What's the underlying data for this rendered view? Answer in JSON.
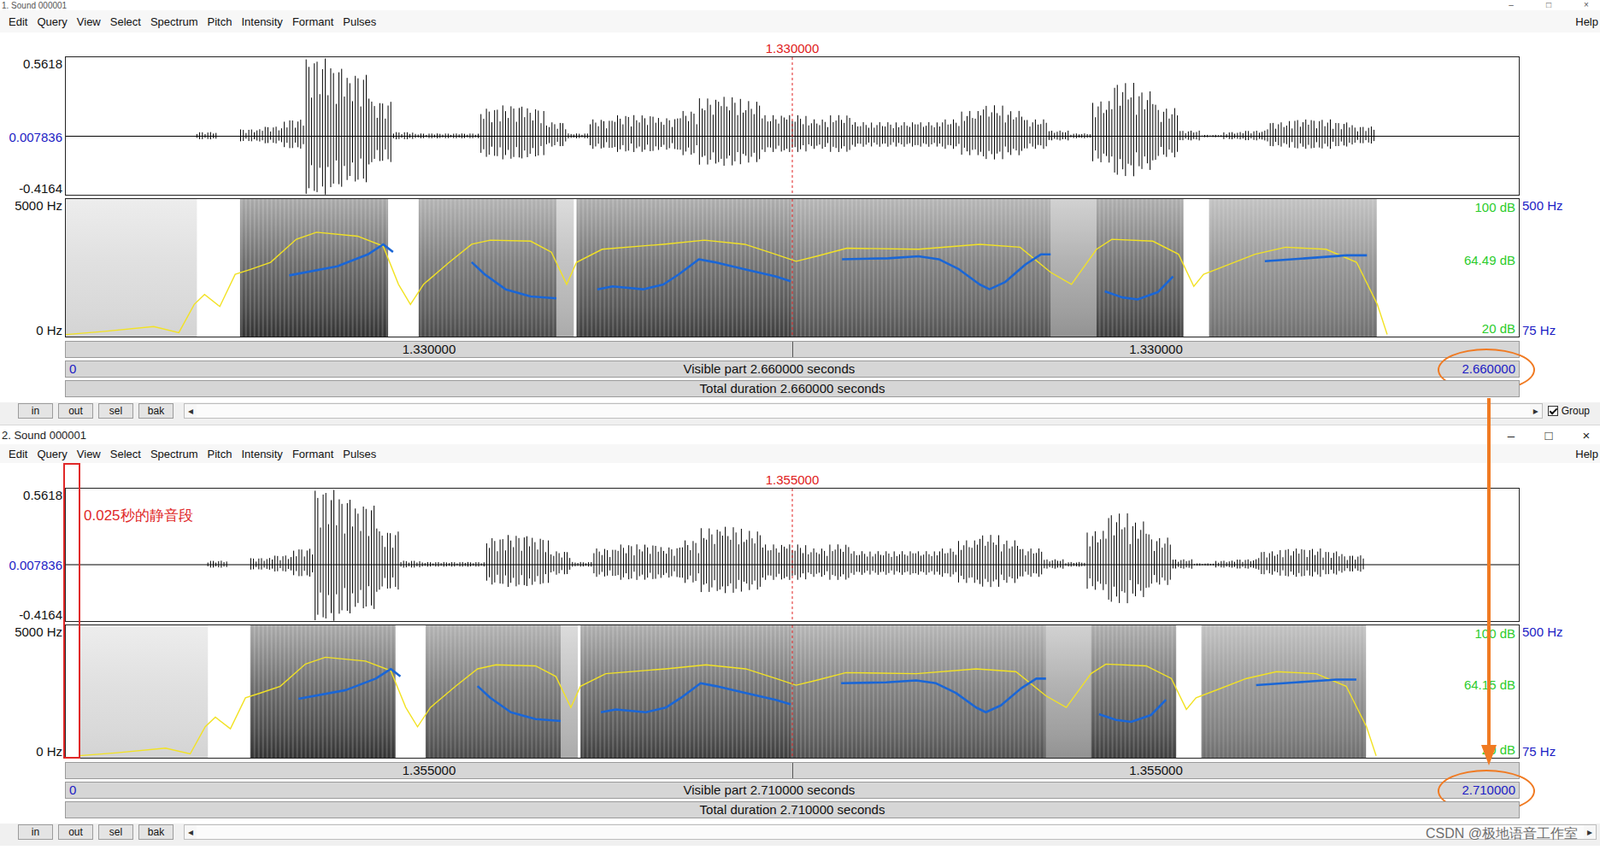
{
  "windows": [
    {
      "title": "1. Sound 000001",
      "controls": [
        "–",
        "□",
        "×"
      ],
      "menus": [
        "Edit",
        "Query",
        "View",
        "Select",
        "Spectrum",
        "Pitch",
        "Intensity",
        "Formant",
        "Pulses"
      ],
      "help": "Help",
      "cursor": "1.330000",
      "signal_offset": 0,
      "waveform": {
        "max": "0.5618",
        "zero": "0.007836",
        "min": "-0.4164"
      },
      "spectrogram": {
        "freq_top": "5000 Hz",
        "freq_bottom": "0 Hz",
        "db_top": "100 dB",
        "db_mean": "64.49 dB",
        "db_bottom": "20 dB",
        "pitch_top": "500 Hz",
        "pitch_bottom": "75 Hz"
      },
      "time_bar": [
        "1.330000",
        "1.330000"
      ],
      "visible": {
        "start": "0",
        "label": "Visible part 2.660000 seconds",
        "end": "2.660000",
        "circled": true
      },
      "total": "Total duration 2.660000 seconds",
      "buttons": [
        "in",
        "out",
        "sel",
        "bak"
      ],
      "scroll_left": "◂",
      "scroll_right": "▸",
      "group": {
        "label": "Group",
        "checked": true
      },
      "silence_note": null
    },
    {
      "title": "2. Sound 000001",
      "controls": [
        "–",
        "□",
        "×"
      ],
      "menus": [
        "Edit",
        "Query",
        "View",
        "Select",
        "Spectrum",
        "Pitch",
        "Intensity",
        "Formant",
        "Pulses"
      ],
      "help": "Help",
      "cursor": "1.355000",
      "signal_offset": 0.025,
      "waveform": {
        "max": "0.5618",
        "zero": "0.007836",
        "min": "-0.4164"
      },
      "spectrogram": {
        "freq_top": "5000 Hz",
        "freq_bottom": "0 Hz",
        "db_top": "100 dB",
        "db_mean": "64.15 dB",
        "db_bottom": "20 dB",
        "pitch_top": "500 Hz",
        "pitch_bottom": "75 Hz"
      },
      "time_bar": [
        "1.355000",
        "1.355000"
      ],
      "visible": {
        "start": "0",
        "label": "Visible part 2.710000 seconds",
        "end": "2.710000",
        "circled": true
      },
      "total": "Total duration 2.710000 seconds",
      "buttons": [
        "in",
        "out",
        "sel",
        "bak"
      ],
      "scroll_left": "◂",
      "scroll_right": "▸",
      "group": null,
      "silence_note": "0.025秒的静音段"
    }
  ],
  "signal": {
    "bin_seconds": 0.04,
    "envelope": [
      0,
      0,
      0,
      0,
      0,
      0,
      0.03,
      0,
      0.05,
      0.07,
      0.12,
      0.56,
      0.5,
      0.45,
      0.25,
      0.03,
      0.02,
      0.02,
      0.02,
      0.2,
      0.22,
      0.2,
      0.1,
      0.02,
      0.12,
      0.15,
      0.15,
      0.13,
      0.18,
      0.27,
      0.28,
      0.25,
      0.15,
      0.15,
      0.12,
      0.15,
      0.1,
      0.1,
      0.1,
      0.1,
      0.12,
      0.18,
      0.22,
      0.18,
      0.12,
      0.04,
      0.02,
      0.25,
      0.38,
      0.32,
      0.2,
      0.04,
      0.01,
      0.03,
      0.04,
      0.1,
      0.12,
      0.12,
      0.1,
      0.07
    ],
    "spectrogram_segments": [
      {
        "start": 0,
        "end": 0.24,
        "level": 0.18
      },
      {
        "start": 0.319,
        "end": 0.59,
        "level": 0.85
      },
      {
        "start": 0.646,
        "end": 0.898,
        "level": 0.75
      },
      {
        "start": 0.898,
        "end": 0.93,
        "level": 0.35
      },
      {
        "start": 0.935,
        "end": 1.327,
        "level": 0.8
      },
      {
        "start": 1.327,
        "end": 1.803,
        "level": 0.72
      },
      {
        "start": 1.803,
        "end": 1.887,
        "level": 0.45
      },
      {
        "start": 1.887,
        "end": 2.046,
        "level": 0.8
      },
      {
        "start": 2.093,
        "end": 2.4,
        "level": 0.6
      }
    ],
    "pitch": [
      {
        "times": [
          0.409,
          0.497,
          0.553,
          0.581,
          0.599
        ],
        "hz": [
          264,
          292,
          329,
          360,
          336
        ]
      },
      {
        "times": [
          0.743,
          0.767,
          0.805,
          0.851,
          0.898
        ],
        "hz": [
          305,
          267,
          221,
          199,
          193
        ]
      },
      {
        "times": [
          0.973,
          1.001,
          1.057,
          1.094,
          1.122,
          1.159,
          1.187,
          1.243,
          1.299,
          1.327
        ],
        "hz": [
          221,
          230,
          221,
          236,
          267,
          314,
          305,
          283,
          261,
          246
        ]
      },
      {
        "times": [
          1.421,
          1.505,
          1.561,
          1.598,
          1.635,
          1.673,
          1.691,
          1.719,
          1.757,
          1.785,
          1.803
        ],
        "hz": [
          314,
          317,
          323,
          314,
          283,
          236,
          221,
          243,
          298,
          329,
          329
        ]
      },
      {
        "times": [
          1.902,
          1.934,
          1.962,
          1.999,
          2.027
        ],
        "hz": [
          215,
          196,
          190,
          212,
          261
        ]
      },
      {
        "times": [
          2.195,
          2.27,
          2.345,
          2.382
        ],
        "hz": [
          308,
          317,
          326,
          326
        ]
      }
    ],
    "intensity": {
      "times": [
        0,
        0.067,
        0.161,
        0.207,
        0.235,
        0.254,
        0.282,
        0.31,
        0.338,
        0.375,
        0.422,
        0.459,
        0.534,
        0.581,
        0.609,
        0.631,
        0.655,
        0.702,
        0.743,
        0.777,
        0.851,
        0.889,
        0.917,
        0.935,
        0.982,
        1.094,
        1.169,
        1.243,
        1.299,
        1.337,
        1.374,
        1.43,
        1.561,
        1.673,
        1.747,
        1.803,
        1.841,
        1.887,
        1.915,
        1.99,
        2.037,
        2.065,
        2.083,
        2.121,
        2.177,
        2.233,
        2.307,
        2.363,
        2.401,
        2.419
      ],
      "db": [
        21.2,
        22.9,
        25.8,
        22.3,
        38.7,
        44.5,
        37.5,
        56.2,
        59.1,
        63.2,
        76.6,
        80.7,
        78.4,
        72.6,
        50.4,
        38.7,
        50.4,
        63.2,
        73.7,
        76.1,
        75.5,
        69.1,
        50.4,
        63.2,
        70.8,
        73.7,
        76.1,
        73.7,
        67.9,
        63.8,
        66.7,
        71.4,
        70.8,
        73.7,
        72.0,
        57.4,
        50.4,
        70.8,
        76.6,
        75.5,
        67.9,
        49.2,
        56.2,
        60.9,
        67.9,
        72.0,
        70.8,
        63.2,
        38.7,
        21.2
      ]
    }
  },
  "watermark": "CSDN @极地语音工作室"
}
